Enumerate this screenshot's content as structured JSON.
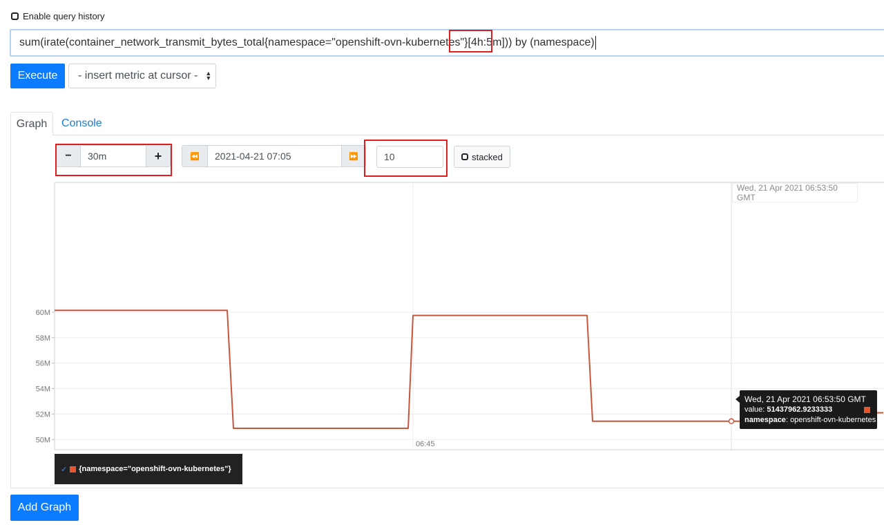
{
  "history": {
    "label": "Enable query history",
    "checked": false
  },
  "query": {
    "value": "sum(irate(container_network_transmit_bytes_total{namespace=\"openshift-ovn-kubernetes\"}[4h:5m])) by (namespace)"
  },
  "toolbar": {
    "execute_label": "Execute",
    "insert_metric_label": "- insert metric at cursor -"
  },
  "tabs": [
    {
      "label": "Graph",
      "active": true
    },
    {
      "label": "Console",
      "active": false
    }
  ],
  "controls": {
    "range_minus": "−",
    "range_value": "30m",
    "range_plus": "+",
    "prev_icon": "⏪",
    "end_time": "2021-04-21 07:05",
    "next_icon": "⏩",
    "resolution": "10",
    "stacked_label": "stacked"
  },
  "chart_data": {
    "type": "line",
    "y_unit": "M",
    "ylim": [
      49.2,
      70.2
    ],
    "y_ticks": [
      "50M",
      "52M",
      "54M",
      "56M",
      "58M",
      "60M"
    ],
    "x_tick_labels": [
      "06:45"
    ],
    "series": [
      {
        "name": "{namespace=\"openshift-ovn-kubernetes\"}",
        "color": "#c9563a",
        "points": [
          [
            0,
            60.15
          ],
          [
            250,
            60.15
          ],
          [
            259,
            50.88
          ],
          [
            512,
            50.88
          ],
          [
            519,
            59.75
          ],
          [
            771,
            59.75
          ],
          [
            779,
            51.44
          ],
          [
            1030,
            51.44
          ],
          [
            1037,
            51.94
          ],
          [
            1040,
            52.1
          ],
          [
            1200,
            52.1
          ]
        ]
      }
    ],
    "hover": {
      "time": "Wed, 21 Apr 2021 06:53:50 GMT",
      "value_label": "value:",
      "value": "51437962.9233333",
      "namespace_label": "namespace",
      "namespace": "openshift-ovn-kubernetes"
    }
  },
  "legend": {
    "check": "✓",
    "label": "{namespace=\"openshift-ovn-kubernetes\"}"
  },
  "add_graph_label": "Add Graph",
  "colors": {
    "primary": "#0b7bff",
    "series": "#c9563a",
    "highlight": "#e21c1c"
  }
}
